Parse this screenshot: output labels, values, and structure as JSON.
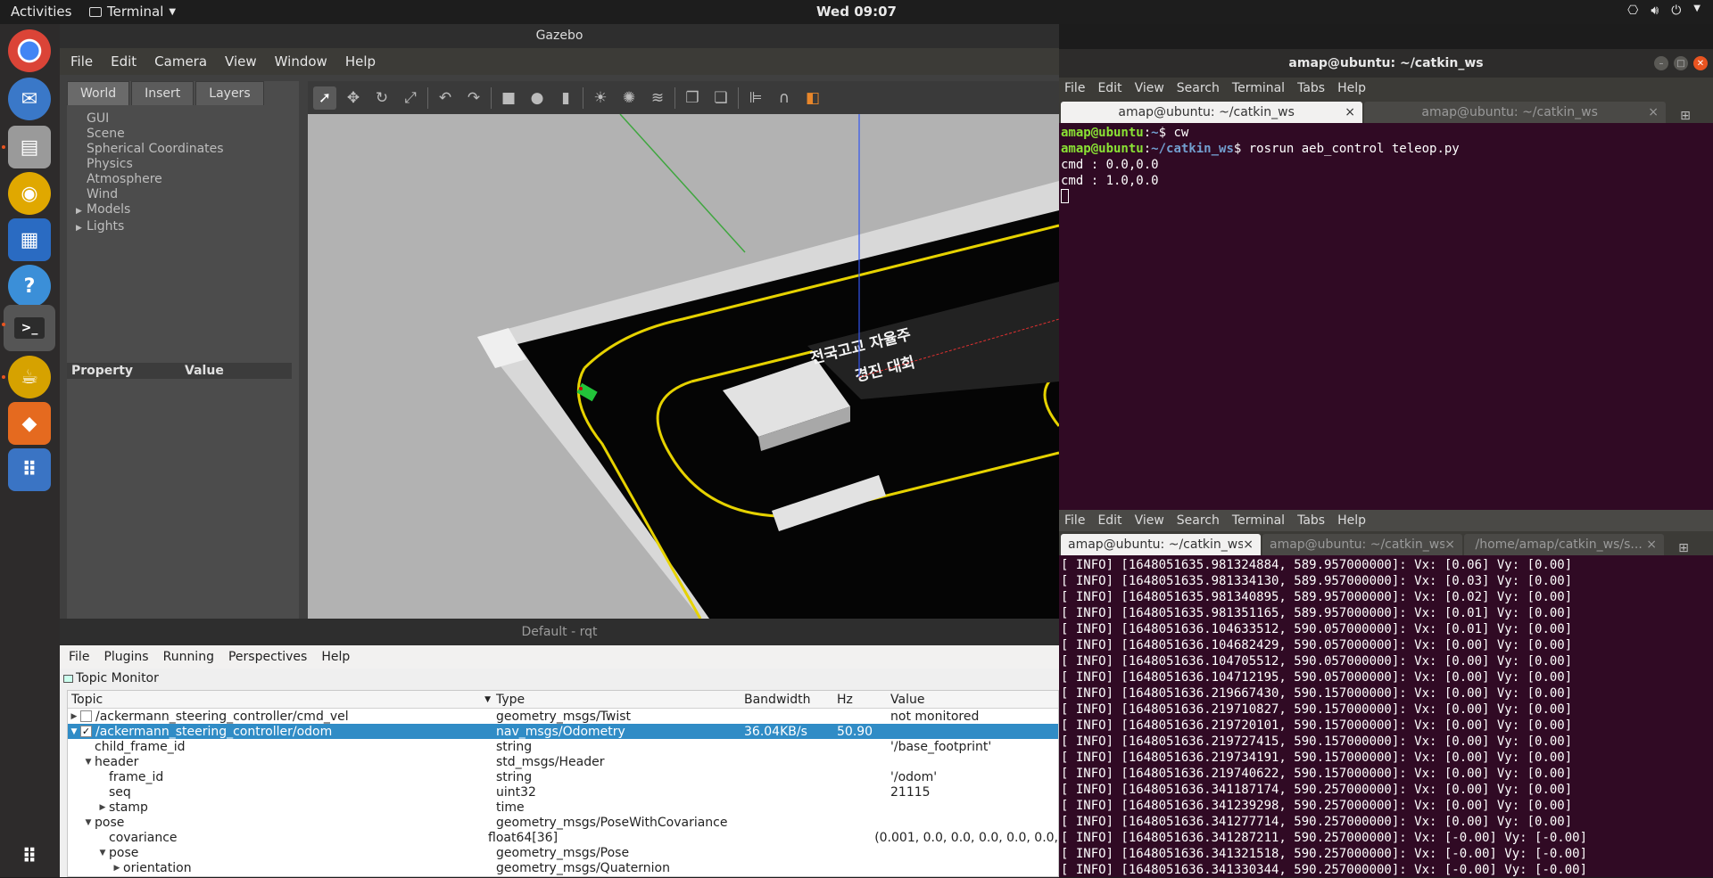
{
  "topbar": {
    "activities": "Activities",
    "app_menu": "Terminal",
    "clock": "Wed 09:07"
  },
  "dock": {
    "items": [
      "chrome-icon",
      "thunderbird-icon",
      "files-icon",
      "rhythmbox-icon",
      "writer-icon",
      "help-icon",
      "terminal-icon",
      "gazebo-icon",
      "ubuntu-software-icon",
      "apps-icon"
    ]
  },
  "gazebo": {
    "title": "Gazebo",
    "menu": [
      "File",
      "Edit",
      "Camera",
      "View",
      "Window",
      "Help"
    ],
    "tabs": [
      "World",
      "Insert",
      "Layers"
    ],
    "tree": [
      "GUI",
      "Scene",
      "Spherical Coordinates",
      "Physics",
      "Atmosphere",
      "Wind",
      "Models",
      "Lights"
    ],
    "prop_header": {
      "property": "Property",
      "value": "Value"
    },
    "track_text": [
      "전국고교 자율주",
      "경진 대회"
    ]
  },
  "term1": {
    "title": "amap@ubuntu: ~/catkin_ws",
    "menu": [
      "File",
      "Edit",
      "View",
      "Search",
      "Terminal",
      "Tabs",
      "Help"
    ],
    "tabs": [
      "amap@ubuntu: ~/catkin_ws",
      "amap@ubuntu: ~/catkin_ws"
    ],
    "lines": [
      {
        "user": "amap@ubuntu",
        "path": "~",
        "cmd": "$ cw"
      },
      {
        "user": "amap@ubuntu",
        "path": "~/catkin_ws",
        "cmd": "$ rosrun aeb_control teleop.py"
      }
    ],
    "output": [
      "cmd : 0.0,0.0",
      "cmd : 1.0,0.0"
    ]
  },
  "term2": {
    "menu": [
      "File",
      "Edit",
      "View",
      "Search",
      "Terminal",
      "Tabs",
      "Help"
    ],
    "tabs": [
      "amap@ubuntu: ~/catkin_ws",
      "amap@ubuntu: ~/catkin_ws",
      "/home/amap/catkin_ws/s..."
    ],
    "lines": [
      "[ INFO] [1648051635.981324884, 589.957000000]: Vx: [0.06] Vy: [0.00]",
      "[ INFO] [1648051635.981334130, 589.957000000]: Vx: [0.03] Vy: [0.00]",
      "[ INFO] [1648051635.981340895, 589.957000000]: Vx: [0.02] Vy: [0.00]",
      "[ INFO] [1648051635.981351165, 589.957000000]: Vx: [0.01] Vy: [0.00]",
      "[ INFO] [1648051636.104633512, 590.057000000]: Vx: [0.01] Vy: [0.00]",
      "[ INFO] [1648051636.104682429, 590.057000000]: Vx: [0.00] Vy: [0.00]",
      "[ INFO] [1648051636.104705512, 590.057000000]: Vx: [0.00] Vy: [0.00]",
      "[ INFO] [1648051636.104712195, 590.057000000]: Vx: [0.00] Vy: [0.00]",
      "[ INFO] [1648051636.219667430, 590.157000000]: Vx: [0.00] Vy: [0.00]",
      "[ INFO] [1648051636.219710827, 590.157000000]: Vx: [0.00] Vy: [0.00]",
      "[ INFO] [1648051636.219720101, 590.157000000]: Vx: [0.00] Vy: [0.00]",
      "[ INFO] [1648051636.219727415, 590.157000000]: Vx: [0.00] Vy: [0.00]",
      "[ INFO] [1648051636.219734191, 590.157000000]: Vx: [0.00] Vy: [0.00]",
      "[ INFO] [1648051636.219740622, 590.157000000]: Vx: [0.00] Vy: [0.00]",
      "[ INFO] [1648051636.341187174, 590.257000000]: Vx: [0.00] Vy: [0.00]",
      "[ INFO] [1648051636.341239298, 590.257000000]: Vx: [0.00] Vy: [0.00]",
      "[ INFO] [1648051636.341277714, 590.257000000]: Vx: [0.00] Vy: [0.00]",
      "[ INFO] [1648051636.341287211, 590.257000000]: Vx: [-0.00] Vy: [-0.00]",
      "[ INFO] [1648051636.341321518, 590.257000000]: Vx: [-0.00] Vy: [-0.00]",
      "[ INFO] [1648051636.341330344, 590.257000000]: Vx: [-0.00] Vy: [-0.00]"
    ]
  },
  "rqt": {
    "title": "Default - rqt",
    "menu": [
      "File",
      "Plugins",
      "Running",
      "Perspectives",
      "Help"
    ],
    "plugin": "Topic Monitor",
    "columns": [
      "Topic",
      "Type",
      "Bandwidth",
      "Hz",
      "Value"
    ],
    "rows": [
      {
        "indent": 0,
        "arrow": "▶",
        "check": "",
        "topic": "/ackermann_steering_controller/cmd_vel",
        "type": "geometry_msgs/Twist",
        "bw": "",
        "hz": "",
        "value": "not monitored"
      },
      {
        "indent": 0,
        "arrow": "▼",
        "check": "✓",
        "topic": "/ackermann_steering_controller/odom",
        "type": "nav_msgs/Odometry",
        "bw": "36.04KB/s",
        "hz": "50.90",
        "value": ""
      },
      {
        "indent": 1,
        "arrow": "",
        "topic": "child_frame_id",
        "type": "string",
        "bw": "",
        "hz": "",
        "value": "'/base_footprint'"
      },
      {
        "indent": 1,
        "arrow": "▼",
        "topic": "header",
        "type": "std_msgs/Header",
        "bw": "",
        "hz": "",
        "value": ""
      },
      {
        "indent": 2,
        "arrow": "",
        "topic": "frame_id",
        "type": "string",
        "bw": "",
        "hz": "",
        "value": "'/odom'"
      },
      {
        "indent": 2,
        "arrow": "",
        "topic": "seq",
        "type": "uint32",
        "bw": "",
        "hz": "",
        "value": "21115"
      },
      {
        "indent": 2,
        "arrow": "▶",
        "topic": "stamp",
        "type": "time",
        "bw": "",
        "hz": "",
        "value": ""
      },
      {
        "indent": 1,
        "arrow": "▼",
        "topic": "pose",
        "type": "geometry_msgs/PoseWithCovariance",
        "bw": "",
        "hz": "",
        "value": ""
      },
      {
        "indent": 2,
        "arrow": "",
        "topic": "covariance",
        "type": "float64[36]",
        "bw": "",
        "hz": "",
        "value": "(0.001, 0.0, 0.0, 0.0, 0.0, 0.0,"
      },
      {
        "indent": 2,
        "arrow": "▼",
        "topic": "pose",
        "type": "geometry_msgs/Pose",
        "bw": "",
        "hz": "",
        "value": ""
      },
      {
        "indent": 3,
        "arrow": "▶",
        "topic": "orientation",
        "type": "geometry_msgs/Quaternion",
        "bw": "",
        "hz": "",
        "value": ""
      }
    ]
  }
}
